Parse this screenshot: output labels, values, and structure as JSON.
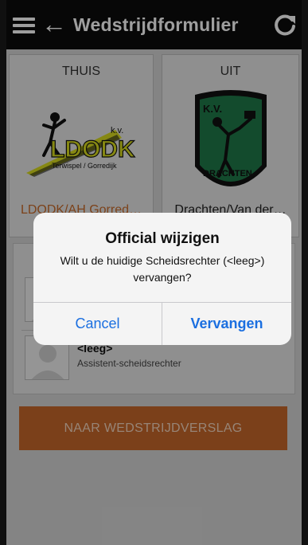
{
  "header": {
    "title": "Wedstrijdformulier",
    "menu_icon": "hamburger-menu-icon",
    "back_icon": "arrow-left-icon",
    "refresh_icon": "refresh-icon"
  },
  "teams": {
    "home": {
      "label": "THUIS",
      "name": "LDODK/AH Gorred…",
      "logo": {
        "top_text": "k.v.",
        "main_text": "LDODK",
        "sub_text": "Terwispel / Gorredijk"
      }
    },
    "away": {
      "label": "UIT",
      "name": "Drachten/Van der…",
      "logo": {
        "top_text": "K.V.",
        "arc_text": "DRACHTEN"
      }
    }
  },
  "officials": [
    {
      "name": "",
      "role": ""
    },
    {
      "name": "<leeg>",
      "role": "Assistent-scheidsrechter"
    }
  ],
  "report_button": {
    "label": "NAAR WEDSTRIJDVERSLAG"
  },
  "dialog": {
    "title": "Official wijzigen",
    "message": "Wilt u de huidige Scheidsrechter (<leeg>) vervangen?",
    "cancel_label": "Cancel",
    "confirm_label": "Vervangen"
  },
  "colors": {
    "accent_orange": "#c7682a",
    "ios_blue": "#1b6fe0",
    "away_logo_green": "#1f7a4a"
  }
}
